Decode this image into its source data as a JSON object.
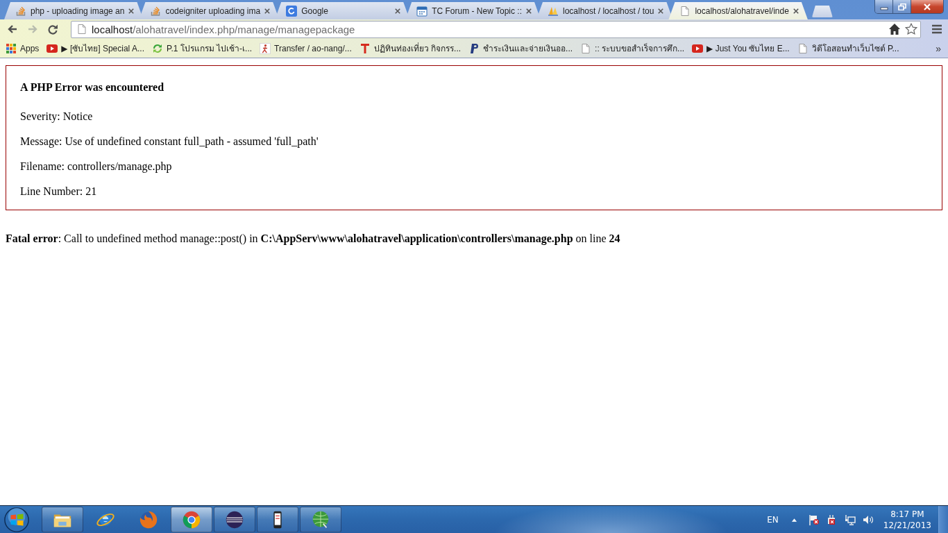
{
  "tabs": [
    {
      "title": "php - uploading image an",
      "kind": "stack",
      "selected": false
    },
    {
      "title": "codeigniter uploading ima",
      "kind": "stack",
      "selected": false
    },
    {
      "title": "Google",
      "kind": "tile",
      "selected": false
    },
    {
      "title": "TC Forum - New Topic ::",
      "kind": "calendar",
      "selected": false
    },
    {
      "title": "localhost / localhost / tou",
      "kind": "sails",
      "selected": false
    },
    {
      "title": "localhost/alohatravel/inde",
      "kind": "page",
      "selected": true
    }
  ],
  "toolbar": {
    "back_disabled": false,
    "forward_disabled": true,
    "address": {
      "host": "localhost",
      "path": "/alohatravel/index.php/manage/managepackage"
    },
    "bookmarked": false
  },
  "bookmarks": {
    "items": [
      {
        "label": "Apps",
        "kind": "apps"
      },
      {
        "label": "▶ [ซับไทย] Special A...",
        "kind": "video"
      },
      {
        "label": "P.1 โปรแกรม ไปเช้า-เ...",
        "kind": "arrows"
      },
      {
        "label": "Transfer / ao-nang/...",
        "kind": "runner"
      },
      {
        "label": "ปฏิทินท่องเที่ยว กิจกรร...",
        "kind": "tbar"
      },
      {
        "label": "ชำระเงินและจ่ายเงินออ...",
        "kind": "slanted"
      },
      {
        "label": ":: ระบบขอสำเร็จการศึก...",
        "kind": "page"
      },
      {
        "label": "▶ Just You ซับไทย E...",
        "kind": "video"
      },
      {
        "label": "วิดีโอสอนทำเว็บไซต์ P...",
        "kind": "page"
      }
    ],
    "overflow": "»"
  },
  "page": {
    "error_notice": {
      "heading": "A PHP Error was encountered",
      "lines": [
        "Severity: Notice",
        "Message: Use of undefined constant full_path - assumed 'full_path'",
        "Filename: controllers/manage.php",
        "Line Number: 21"
      ]
    },
    "fatal_error": "**Fatal error**: Call to undefined method manage::post() in **C:\\AppServ\\www\\alohatravel\\application\\controllers\\manage.php** on line **24**"
  },
  "taskbar": {
    "apps": [
      {
        "kind": "folder",
        "running": true,
        "selected": false
      },
      {
        "kind": "orbit",
        "running": false,
        "selected": false
      },
      {
        "kind": "fox",
        "running": false,
        "selected": false
      },
      {
        "kind": "wheel",
        "running": true,
        "selected": true
      },
      {
        "kind": "sphere",
        "running": true,
        "selected": false
      },
      {
        "kind": "phone",
        "running": true,
        "selected": false
      },
      {
        "kind": "globe",
        "running": true,
        "selected": false
      }
    ],
    "tray": {
      "language": "EN",
      "time": "8:17 PM",
      "date": "12/21/2013"
    }
  }
}
